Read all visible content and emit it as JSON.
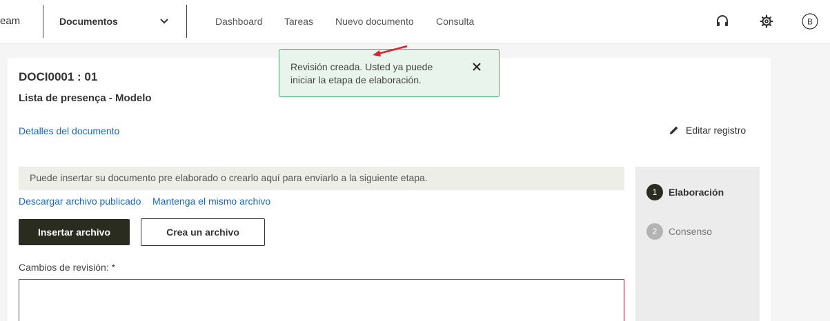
{
  "header": {
    "brand_fragment": "eam",
    "module": "Documentos",
    "nav": [
      "Dashboard",
      "Tareas",
      "Nuevo documento",
      "Consulta"
    ],
    "user_initial": "B",
    "icons": [
      "chevron-down-icon",
      "headset-icon",
      "gear-icon",
      "user-avatar-icon"
    ]
  },
  "toast": {
    "message": "Revisión creada. Usted ya puede iniciar la etapa de elaboración.",
    "close_icon": "close-icon"
  },
  "document": {
    "id": "DOCI0001 : 01",
    "title": "Lista de presença - Modelo",
    "details_link": "Detalles del documento",
    "edit_label": "Editar registro"
  },
  "content": {
    "info": "Puede insertar su documento pre elaborado o crearlo aquí para enviarlo a la siguiente etapa.",
    "download_link": "Descargar archivo publicado",
    "keep_link": "Mantenga el mismo archivo",
    "insert_button": "Insertar archivo",
    "create_button": "Crea un archivo",
    "changes_label": "Cambios de revisión: *",
    "changes_value": ""
  },
  "stepper": {
    "steps": [
      {
        "num": "1",
        "label": "Elaboración",
        "active": true
      },
      {
        "num": "2",
        "label": "Consenso",
        "active": false
      }
    ]
  },
  "colors": {
    "link": "#1a66c4",
    "primary_button": "#2b2c20",
    "toast_bg": "#e8f4ec",
    "toast_border": "#4caf72",
    "required_border": "#a8283a",
    "annotation_arrow": "#e0202a"
  }
}
